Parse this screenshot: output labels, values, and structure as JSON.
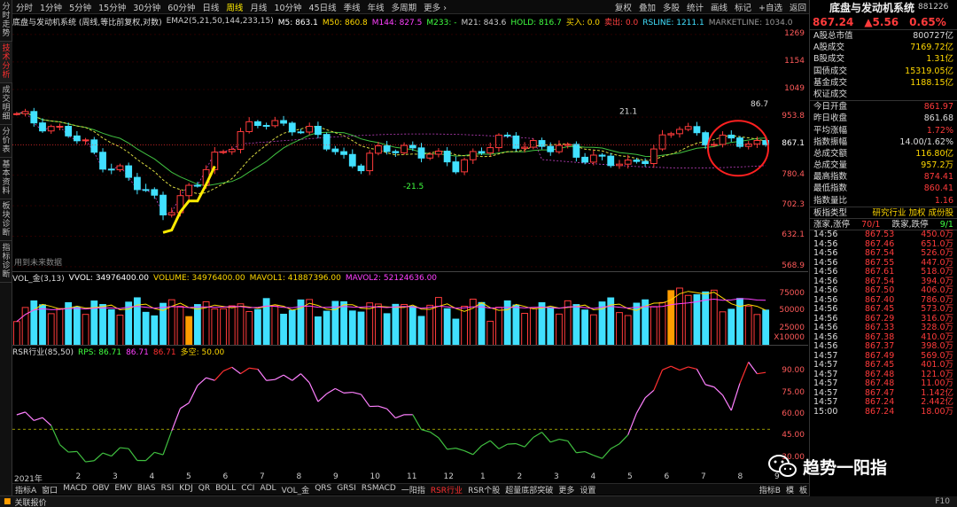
{
  "left_nav": [
    "分时走势",
    "技术分析",
    "成交明细",
    "分价表",
    "基本资料",
    "板块诊断",
    "指标诊断"
  ],
  "left_nav_active": 1,
  "toolbar": {
    "periods": [
      "分时",
      "1分钟",
      "5分钟",
      "15分钟",
      "30分钟",
      "60分钟",
      "日线",
      "周线",
      "月线",
      "10分钟",
      "45日线",
      "季线",
      "年线",
      "多周期",
      "更多 ›"
    ],
    "active_period": 7,
    "right_buttons": [
      "复权",
      "叠加",
      "多股",
      "统计",
      "画线",
      "标记",
      "+自选",
      "返回"
    ]
  },
  "main_chart": {
    "name": "底盘与发动机系统 (周线,等比前复权,对数)",
    "ema_label": "EMA2(5,21,50,144,233,15)",
    "ema_values": [
      {
        "label": "M5: 863.1",
        "color": "#ffffff"
      },
      {
        "label": "M50: 860.8",
        "color": "#ffd800"
      },
      {
        "label": "M144: 827.5",
        "color": "#ff40ff"
      },
      {
        "label": "M233: -",
        "color": "#40ff40"
      },
      {
        "label": "M21: 843.6",
        "color": "#cccccc"
      },
      {
        "label": "HOLD: 816.7",
        "color": "#40ff40"
      },
      {
        "label": "买入: 0.0",
        "color": "#ffd800"
      },
      {
        "label": "卖出: 0.0",
        "color": "#ff4040"
      },
      {
        "label": "RSLINE: 1211.1",
        "color": "#41e0ff"
      },
      {
        "label": "MARKETLINE: 1034.0",
        "color": "#999999"
      }
    ],
    "y_ticks": [
      "1269",
      "1154",
      "1049",
      "953.8",
      "867.1",
      "780.4",
      "702.3",
      "632.1",
      "568.9"
    ],
    "current_price_tick": "867.1",
    "annotations": [
      "86.7",
      "21.1",
      "-21.5"
    ],
    "footer": "用到未来数据"
  },
  "volume_panel": {
    "label": "VOL_金(3,13)",
    "values": [
      {
        "label": "VVOL: 34976400.00",
        "color": "#ffffff"
      },
      {
        "label": "VOLUME: 34976400.00",
        "color": "#ffd800"
      },
      {
        "label": "MAVOL1: 41887396.00",
        "color": "#ffd800"
      },
      {
        "label": "MAVOL2: 52124636.00",
        "color": "#ff40ff"
      }
    ],
    "y_ticks": [
      "75000",
      "50000",
      "25000"
    ],
    "unit": "X10000"
  },
  "rsr_panel": {
    "label": "RSR行业(85,50)",
    "values": [
      {
        "label": "RPS: 86.71",
        "color": "#40ff40"
      },
      {
        "label": "86.71",
        "color": "#ff40ff"
      },
      {
        "label": "86.71",
        "color": "#ff3030"
      },
      {
        "label": "多空: 50.00",
        "color": "#ffd800"
      }
    ],
    "y_ticks": [
      "90.00",
      "75.00",
      "60.00",
      "45.00",
      "30.00"
    ]
  },
  "x_axis": [
    "2021年",
    "2",
    "3",
    "4",
    "5",
    "6",
    "7",
    "8",
    "9",
    "10",
    "11",
    "12",
    "1",
    "2",
    "3",
    "4",
    "5",
    "6",
    "7",
    "8",
    "9"
  ],
  "bottom_tabs": [
    "指标A",
    "窗口",
    "MACD",
    "OBV",
    "EMV",
    "BIAS",
    "RSI",
    "KDJ",
    "QR",
    "BOLL",
    "CCI",
    "ADL",
    "VOL_金",
    "QRS",
    "GRSI",
    "RSMACD",
    "一阳指",
    "RSR行业",
    "RSR个股",
    "超量底部突破",
    "更多",
    "设置"
  ],
  "bottom_tabs_active": 17,
  "bottom_right": [
    "指标B",
    "模",
    "板"
  ],
  "status": {
    "left": "关联报价",
    "right": "F10"
  },
  "right_panel": {
    "title": "底盘与发动机系统",
    "code": "881226",
    "price": "867.24",
    "change": "▲5.56",
    "change_pct": "0.65%",
    "stats1": [
      {
        "k": "A股总市值",
        "v": "800727亿",
        "c": "w"
      },
      {
        "k": "A股成交",
        "v": "7169.72亿",
        "c": "y"
      },
      {
        "k": "B股成交",
        "v": "1.31亿",
        "c": "y"
      },
      {
        "k": "国债成交",
        "v": "15319.05亿",
        "c": "y"
      },
      {
        "k": "基金成交",
        "v": "1188.15亿",
        "c": "y"
      },
      {
        "k": "权证成交",
        "v": "",
        "c": "y"
      }
    ],
    "stats2": [
      {
        "k": "今日开盘",
        "v": "861.97",
        "c": "r"
      },
      {
        "k": "昨日收盘",
        "v": "861.68",
        "c": "w"
      },
      {
        "k": "平均涨幅",
        "v": "1.72%",
        "c": "r"
      },
      {
        "k": "指数振幅",
        "v": "14.00/1.62%",
        "c": "w"
      },
      {
        "k": "总成交额",
        "v": "116.80亿",
        "c": "y"
      },
      {
        "k": "总成交量",
        "v": "957.2万",
        "c": "y"
      },
      {
        "k": "最高指数",
        "v": "874.41",
        "c": "r"
      },
      {
        "k": "最低指数",
        "v": "860.41",
        "c": "r"
      },
      {
        "k": "指数量比",
        "v": "1.16",
        "c": "r"
      }
    ],
    "sector": {
      "k": "板指类型",
      "v": "研究行业 加权 成份股"
    },
    "updown": {
      "up_k": "涨家,涨停",
      "up_v": "70/1",
      "down_k": "跌家,跌停",
      "down_v": "9/1"
    },
    "ticks": [
      {
        "t": "14:56",
        "p": "867.53",
        "v": "450.0万"
      },
      {
        "t": "14:56",
        "p": "867.46",
        "v": "651.0万"
      },
      {
        "t": "14:56",
        "p": "867.54",
        "v": "526.0万"
      },
      {
        "t": "14:56",
        "p": "867.55",
        "v": "447.0万"
      },
      {
        "t": "14:56",
        "p": "867.61",
        "v": "518.0万"
      },
      {
        "t": "14:56",
        "p": "867.54",
        "v": "394.0万"
      },
      {
        "t": "14:56",
        "p": "867.50",
        "v": "406.0万"
      },
      {
        "t": "14:56",
        "p": "867.40",
        "v": "786.0万"
      },
      {
        "t": "14:56",
        "p": "867.45",
        "v": "573.0万"
      },
      {
        "t": "14:56",
        "p": "867.29",
        "v": "316.0万"
      },
      {
        "t": "14:56",
        "p": "867.33",
        "v": "328.0万"
      },
      {
        "t": "14:56",
        "p": "867.38",
        "v": "410.0万"
      },
      {
        "t": "14:56",
        "p": "867.37",
        "v": "398.0万"
      },
      {
        "t": "14:57",
        "p": "867.49",
        "v": "569.0万"
      },
      {
        "t": "14:57",
        "p": "867.45",
        "v": "401.0万"
      },
      {
        "t": "14:57",
        "p": "867.48",
        "v": "121.0万"
      },
      {
        "t": "14:57",
        "p": "867.48",
        "v": "11.00万"
      },
      {
        "t": "14:57",
        "p": "867.47",
        "v": "1.142亿"
      },
      {
        "t": "14:57",
        "p": "867.24",
        "v": "2.442亿"
      },
      {
        "t": "15:00",
        "p": "867.24",
        "v": "18.00万"
      }
    ]
  },
  "watermark": "趋势一阳指",
  "colors": {
    "up": "#ff3b3b",
    "down": "#41e0ff",
    "accent": "#ffeb00",
    "hold_line": "#40ff40"
  }
}
